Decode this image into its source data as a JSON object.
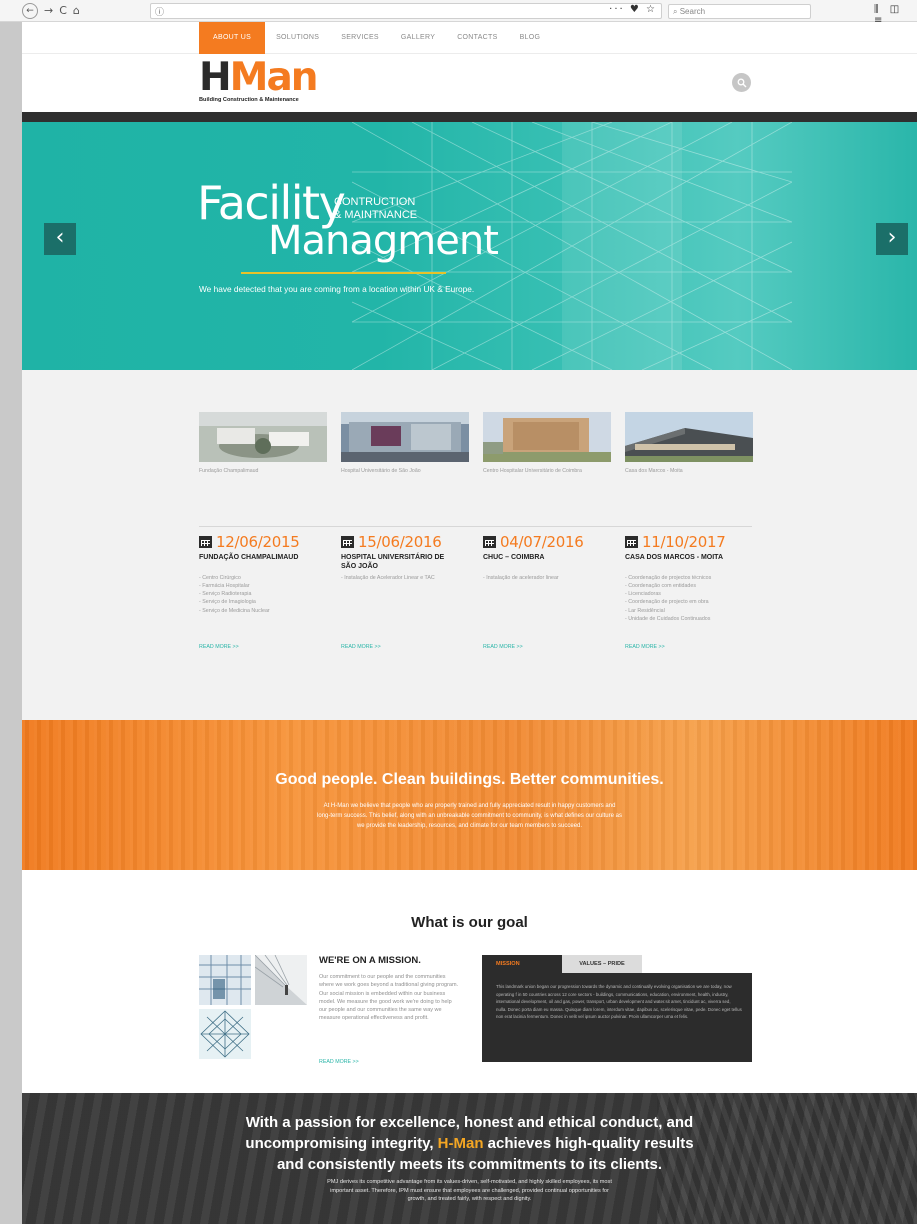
{
  "browser": {
    "search_placeholder": "Search",
    "url_info": "ⓘ",
    "nav_back": "←",
    "nav_forward": "→",
    "nav_reload": "C",
    "nav_home": "⌂",
    "url_icons": "··· ♥ ☆",
    "toolbar_icons": "⫼ ◫ ≡"
  },
  "topnav": {
    "items": [
      {
        "label": "ABOUT US"
      },
      {
        "label": "SOLUTIONS"
      },
      {
        "label": "SERVICES"
      },
      {
        "label": "GALLERY"
      },
      {
        "label": "CONTACTS"
      },
      {
        "label": "BLOG"
      }
    ]
  },
  "logo": {
    "word_h": "H",
    "word_man": "Man",
    "tagline": "Building Construction & Maintenance"
  },
  "hero": {
    "title_facility": "Facility",
    "sub1": "CONTRUCTION",
    "sub2": "& MAINTNANCE",
    "title_man": "Managment",
    "detect_text": "We have detected that you are coming from a location within UK & Europe.",
    "prev": "‹",
    "next": "›"
  },
  "projects": {
    "thumb_captions": [
      "Fundação Champalimaud",
      "Hospital Universitário de São João",
      "Centro Hospitalar Universitário de Coimbra",
      "Casa dos Marcos - Moita"
    ],
    "items": [
      {
        "date": "12/06/2015",
        "name": "FUNDAÇÃO CHAMPALIMAUD",
        "bullets": [
          "- Centro Cirúrgico",
          "- Farmácia Hospitalar",
          "- Serviço Radioterapia",
          "- Serviço de Imagiologia",
          "- Serviço de Medicina Nuclear"
        ],
        "read_more": "READ MORE >>"
      },
      {
        "date": "15/06/2016",
        "name": "HOSPITAL UNIVERSITÁRIO DE SÃO JOÃO",
        "bullets": [
          "- Instalação de Acelerador Linear e TAC"
        ],
        "read_more": "READ MORE >>"
      },
      {
        "date": "04/07/2016",
        "name": "CHUC – COIMBRA",
        "bullets": [
          "- Instalação de acelerador linear"
        ],
        "read_more": "READ MORE >>"
      },
      {
        "date": "11/10/2017",
        "name": "CASA DOS MARCOS - MOITA",
        "bullets": [
          "- Coordenação de projectos técnicos",
          "- Coordenação com entidades",
          "- Licenciadoras",
          "- Coordenação de projecto em obra",
          "- Lar Residêncial",
          "- Unidade de Cuidados Continuados"
        ],
        "read_more": "READ MORE >>"
      }
    ]
  },
  "orange": {
    "heading": "Good people. Clean buildings. Better communities.",
    "line1": "At H-Man we believe that people who are properly trained and fully appreciated result in happy customers and",
    "line2": "long-term success. This belief, along with an unbreakable commitment to community, is what defines our culture as",
    "line3": "we provide the leadership, resources, and climate for our team members to succeed."
  },
  "goal": {
    "heading": "What is our goal",
    "mission_title": "WE'RE ON A MISSION.",
    "mission_text": "Our commitment to our people and the communities where we work goes beyond a traditional giving program. Our social mission is embedded within our business model. We measure the good work we're doing to help our people and our communities the same way we measure operational effectiveness and profit.",
    "read_more": "READ MORE >>",
    "tab_mission": "MISSION",
    "tab_values": "VALUES – PRIDE",
    "tab_text": "This landmark union began our progression towards the dynamic and continually evolving organisation we are today, now operating f in 50 countries across 12 core sectors - buildings, communications, education, environment, health, industry, international development, oil and gas, power, transport, urban development and water.sit amet, tincidunt ac, viverra sed, nulla. Donec porta diam eu massa. Quisque diam lorem, interdum vitae, dapibus ac, scelerisque vitae, pede. Donec eget tellus non erat lacinia fermentum. Donec in velit vel ipsum auctor pulvinar. Proin ullamcorper urna et felis."
  },
  "dark": {
    "line1": "With a passion for excellence, honest and ethical conduct, and",
    "line2_pre": "uncompromising integrity, ",
    "brand": "H-Man",
    "line2_post": " achieves high-quality results",
    "line3": "and consistently meets its commitments to its clients.",
    "p1": "PMJ derives its competitive advantage from its values-driven, self-motivated, and highly skilled employees, its most",
    "p2": "important asset. Therefore, IPM must ensure that employees are challenged, provided continual opportunities for",
    "p3": "growth, and treated fairly, with respect and dignity."
  }
}
